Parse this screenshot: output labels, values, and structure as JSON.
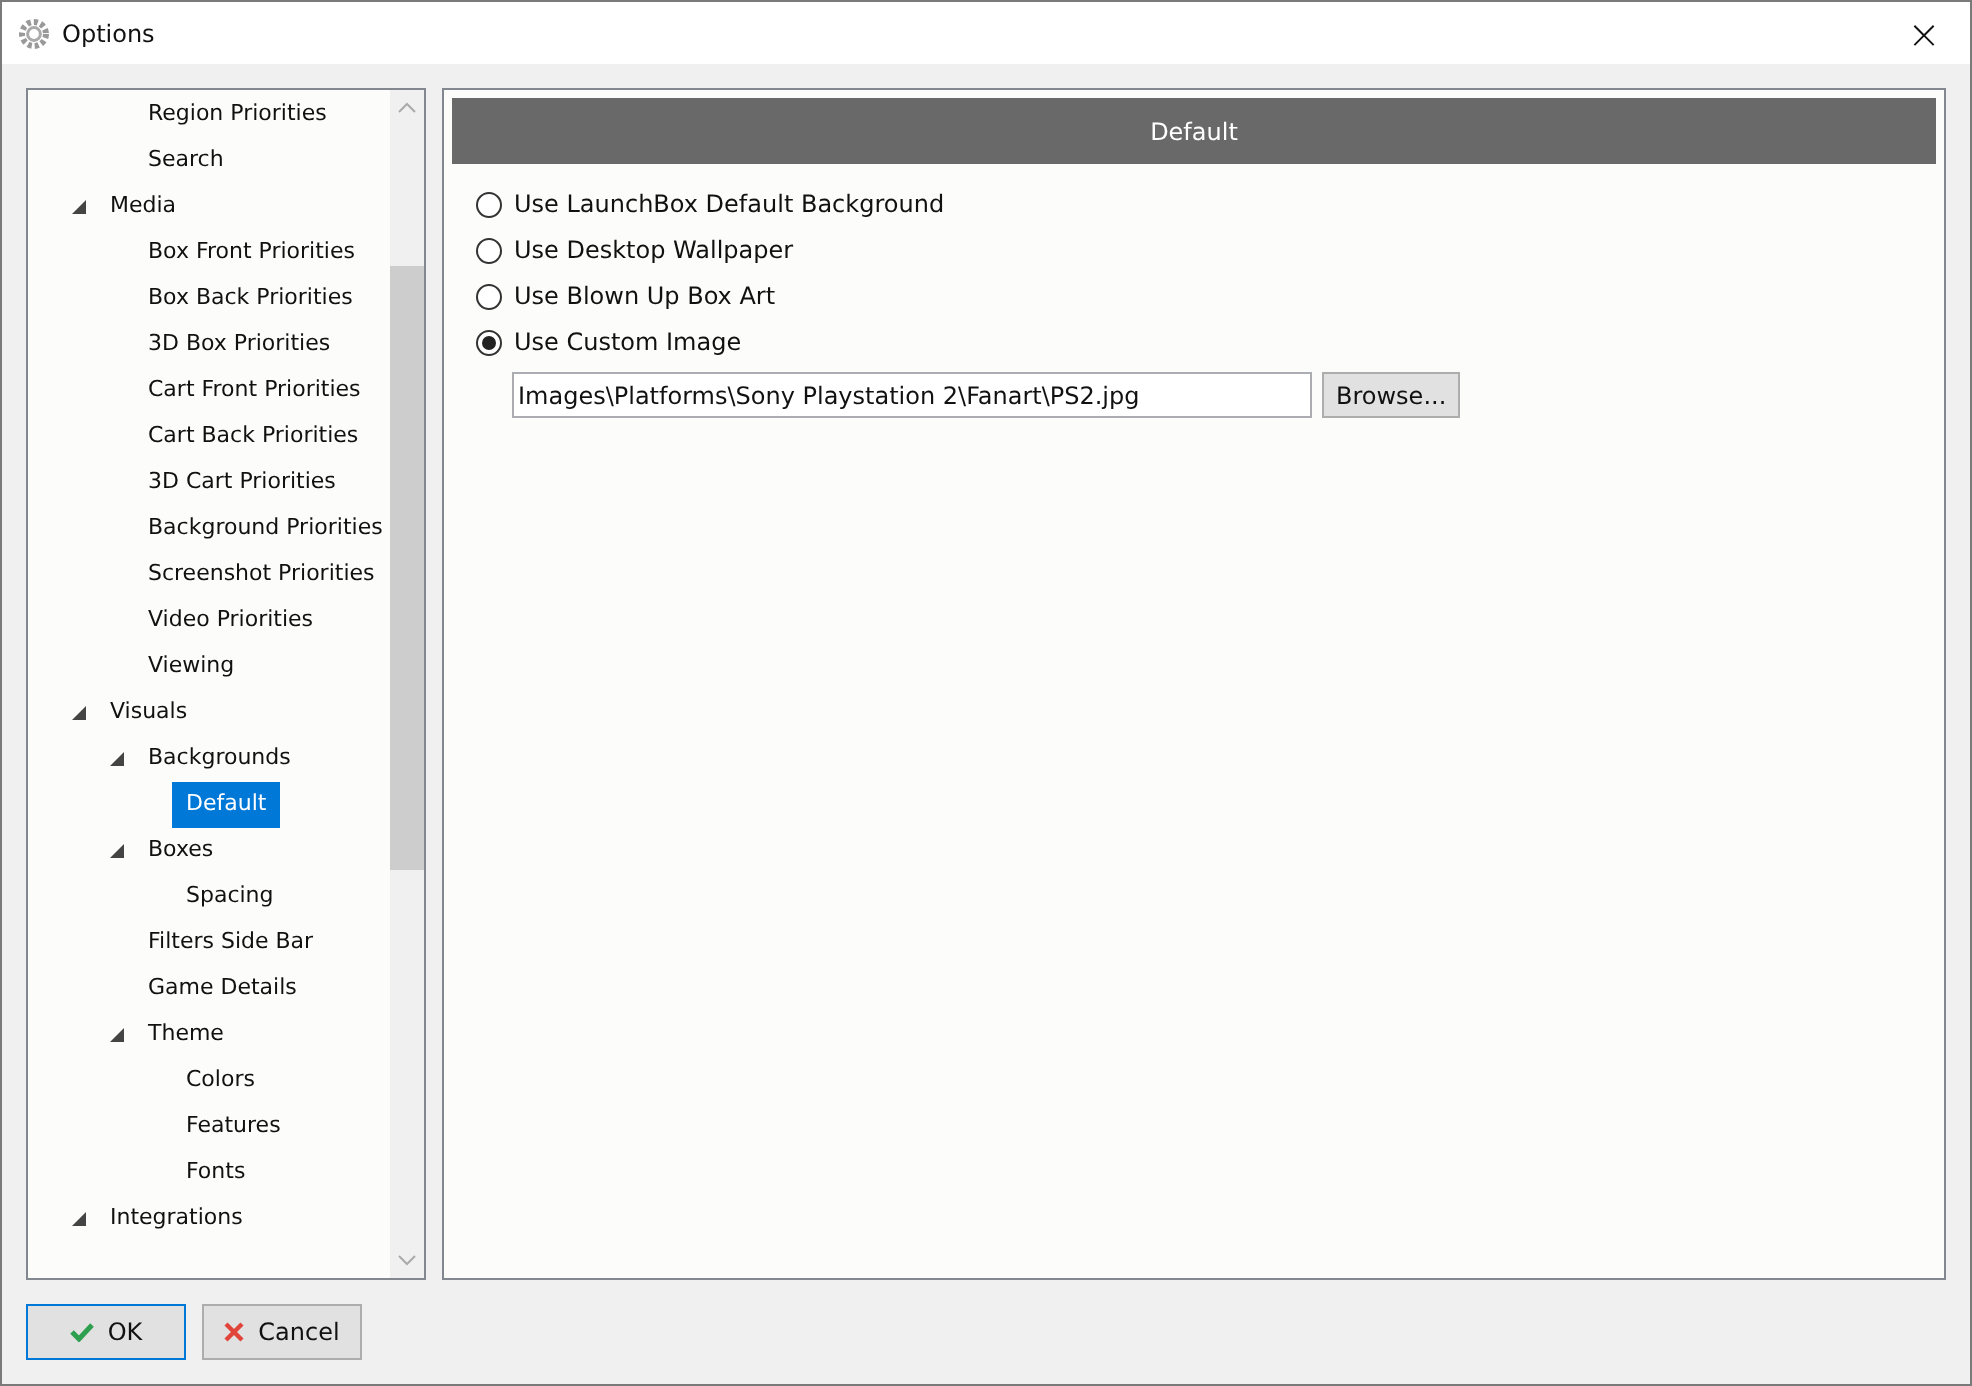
{
  "window": {
    "title": "Options",
    "close": "×"
  },
  "tree": [
    {
      "children": [
        {
          "label": "Region Priorities",
          "selected": false
        },
        {
          "label": "Search",
          "selected": false
        }
      ]
    },
    {
      "label": "Media",
      "selected": false,
      "expanded": true,
      "children": [
        {
          "label": "Box Front Priorities",
          "selected": false
        },
        {
          "label": "Box Back Priorities",
          "selected": false
        },
        {
          "label": "3D Box Priorities",
          "selected": false
        },
        {
          "label": "Cart Front Priorities",
          "selected": false
        },
        {
          "label": "Cart Back Priorities",
          "selected": false
        },
        {
          "label": "3D Cart Priorities",
          "selected": false
        },
        {
          "label": "Background Priorities",
          "selected": false
        },
        {
          "label": "Screenshot Priorities",
          "selected": false
        },
        {
          "label": "Video Priorities",
          "selected": false
        },
        {
          "label": "Viewing",
          "selected": false
        }
      ]
    },
    {
      "label": "Visuals",
      "selected": false,
      "expanded": true,
      "children": [
        {
          "label": "Backgrounds",
          "selected": false,
          "expanded": true,
          "children": [
            {
              "label": "Default",
              "selected": true
            }
          ]
        },
        {
          "label": "Boxes",
          "selected": false,
          "expanded": true,
          "children": [
            {
              "label": "Spacing",
              "selected": false
            }
          ]
        },
        {
          "label": "Filters Side Bar",
          "selected": false
        },
        {
          "label": "Game Details",
          "selected": false
        },
        {
          "label": "Theme",
          "selected": false,
          "expanded": true,
          "children": [
            {
              "label": "Colors",
              "selected": false
            },
            {
              "label": "Features",
              "selected": false
            },
            {
              "label": "Fonts",
              "selected": false
            }
          ]
        }
      ]
    },
    {
      "label": "Integrations",
      "selected": false,
      "expanded": true
    }
  ],
  "panel": {
    "header": "Default",
    "options": [
      {
        "label": "Use LaunchBox Default Background",
        "selected": false
      },
      {
        "label": "Use Desktop Wallpaper",
        "selected": false
      },
      {
        "label": "Use Blown Up Box Art",
        "selected": false
      },
      {
        "label": "Use Custom Image",
        "selected": true
      }
    ],
    "path_field": {
      "value": "Images\\Platforms\\Sony Playstation 2\\Fanart\\PS2.jpg"
    },
    "browse_button": "Browse..."
  },
  "buttons": [
    {
      "kind": "ok",
      "label": "OK"
    },
    {
      "kind": "cancel",
      "label": "Cancel"
    }
  ]
}
